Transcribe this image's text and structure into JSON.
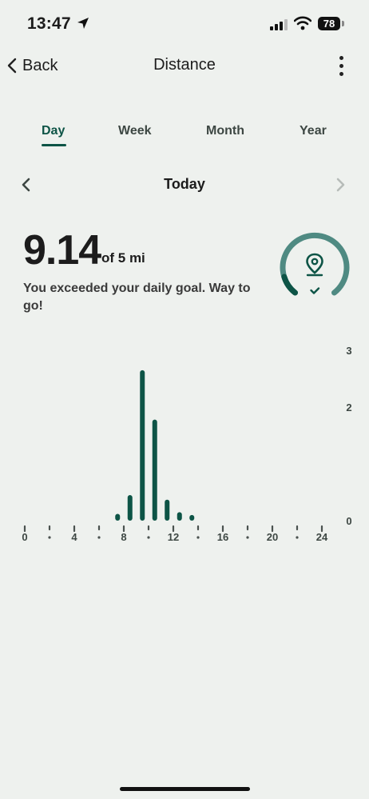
{
  "status_bar": {
    "time": "13:47",
    "battery": "78"
  },
  "header": {
    "back_label": "Back",
    "title": "Distance"
  },
  "tabs": [
    {
      "label": "Day",
      "active": true
    },
    {
      "label": "Week",
      "active": false
    },
    {
      "label": "Month",
      "active": false
    },
    {
      "label": "Year",
      "active": false
    }
  ],
  "date_nav": {
    "label": "Today"
  },
  "summary": {
    "value": "9.14",
    "goal": "of 5 mi",
    "message": "You exceeded your daily goal. Way to go!",
    "goal_progress": 1.83
  },
  "colors": {
    "accent": "#0d5446",
    "ring": "#4f8a82",
    "background": "#eef1ee"
  },
  "chart_data": {
    "type": "bar",
    "x_tick_labels": [
      "0",
      "4",
      "8",
      "12",
      "16",
      "20",
      "24"
    ],
    "x_ticks": [
      0,
      4,
      8,
      12,
      16,
      20,
      24
    ],
    "y_ticks": [
      0,
      2,
      3
    ],
    "y_tick_labels": [
      "0",
      "2",
      "3"
    ],
    "ylim": [
      0,
      3
    ],
    "xlim": [
      0,
      24
    ],
    "bars": [
      {
        "hour": 7,
        "value": 0.12
      },
      {
        "hour": 8,
        "value": 0.45
      },
      {
        "hour": 9,
        "value": 2.65
      },
      {
        "hour": 10,
        "value": 1.78
      },
      {
        "hour": 11,
        "value": 0.37
      },
      {
        "hour": 12,
        "value": 0.15
      },
      {
        "hour": 13,
        "value": 0.1
      }
    ]
  }
}
